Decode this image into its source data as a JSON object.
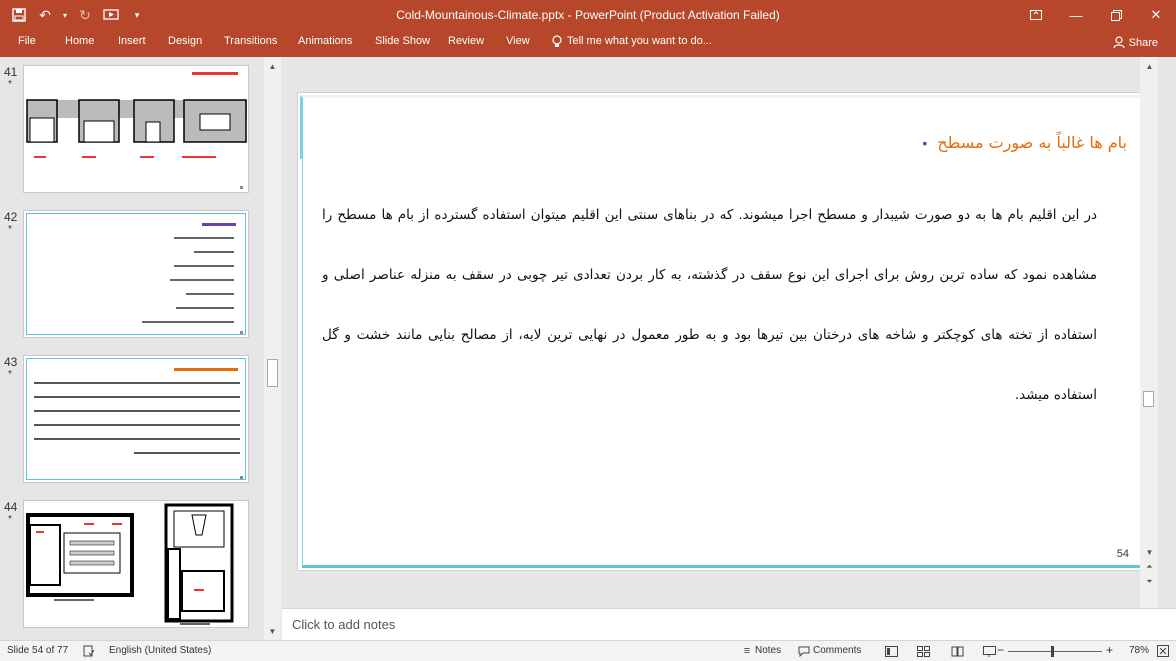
{
  "window": {
    "title": "Cold-Mountainous-Climate.pptx - PowerPoint (Product Activation Failed)"
  },
  "ribbon": {
    "file": "File",
    "tabs": [
      "Home",
      "Insert",
      "Design",
      "Transitions",
      "Animations",
      "Slide Show",
      "Review",
      "View"
    ],
    "tell_me": "Tell me what you want to do...",
    "share": "Share"
  },
  "thumbnails": [
    {
      "number": "41",
      "star": "*"
    },
    {
      "number": "42",
      "star": "*"
    },
    {
      "number": "43",
      "star": "*"
    },
    {
      "number": "44",
      "star": "*"
    }
  ],
  "slide": {
    "bullet": "بام ها غالباً به صورت مسطح",
    "paragraph": "در این اقلیم بام ها به دو صورت شیبدار و مسطح اجرا میشوند. که در بناهای سنتی این اقلیم میتوان استفاده گسترده از بام ها مسطح را مشاهده نمود که ساده ترین روش برای اجرای این نوع سقف در گذشته، به کار بردن تعدادی تیر چوبی در سقف به منزله عناصر اصلی و استفاده از تخته های کوچکتر و شاخه های درختان بین تیرها بود و به طور معمول در نهایی ترین لایه، از مصالح بنایی مانند خشت و گل استفاده میشد.",
    "number": "54"
  },
  "notes": {
    "placeholder": "Click to add notes"
  },
  "status": {
    "slide_info": "Slide 54 of 77",
    "language": "English (United States)",
    "notes": "Notes",
    "comments": "Comments",
    "zoom": "78%"
  },
  "colors": {
    "accent": "#b7472a",
    "slide_frame": "#5fc4d6",
    "bullet_text": "#e46c0a",
    "bullet_dot": "#6a3fb0"
  }
}
